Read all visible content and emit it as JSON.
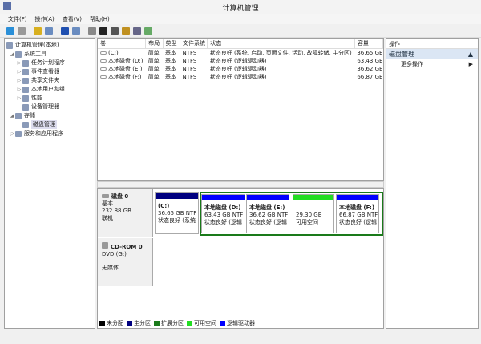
{
  "window": {
    "title": "计算机管理"
  },
  "menu": [
    "文件(F)",
    "操作(A)",
    "查看(V)",
    "帮助(H)"
  ],
  "toolbar_icons": [
    "back-icon",
    "forward-icon",
    "up-icon",
    "console-tree-icon",
    "help-icon",
    "properties-view-icon",
    "refresh-icon",
    "delete-icon",
    "properties-icon",
    "open-icon",
    "search-icon",
    "settings-icon"
  ],
  "tree": [
    {
      "label": "计算机管理(本地)",
      "level": 0,
      "icon": "computer-icon"
    },
    {
      "label": "系统工具",
      "level": 1,
      "icon": "tools-icon",
      "exp": "◢"
    },
    {
      "label": "任务计划程序",
      "level": 2,
      "icon": "clock-icon",
      "exp": "▷"
    },
    {
      "label": "事件查看器",
      "level": 2,
      "icon": "event-icon",
      "exp": "▷"
    },
    {
      "label": "共享文件夹",
      "level": 2,
      "icon": "folder-icon",
      "exp": "▷"
    },
    {
      "label": "本地用户和组",
      "level": 2,
      "icon": "users-icon",
      "exp": "▷"
    },
    {
      "label": "性能",
      "level": 2,
      "icon": "performance-icon",
      "exp": "▷"
    },
    {
      "label": "设备管理器",
      "level": 2,
      "icon": "device-icon",
      "exp": ""
    },
    {
      "label": "存储",
      "level": 1,
      "icon": "storage-icon",
      "exp": "◢"
    },
    {
      "label": "磁盘管理",
      "level": 2,
      "icon": "disk-icon",
      "exp": "",
      "selected": true
    },
    {
      "label": "服务和应用程序",
      "level": 1,
      "icon": "services-icon",
      "exp": "▷"
    }
  ],
  "volumes": {
    "headers": [
      "卷",
      "布局",
      "类型",
      "文件系统",
      "状态",
      "容量"
    ],
    "rows": [
      [
        "(C:)",
        "简单",
        "基本",
        "NTFS",
        "状态良好 (系统, 启动, 页面文件, 活动, 故障转储, 主分区)",
        "36.65 GE"
      ],
      [
        "本地磁盘 (D:)",
        "简单",
        "基本",
        "NTFS",
        "状态良好 (逻辑驱动器)",
        "63.43 GE"
      ],
      [
        "本地磁盘 (E:)",
        "简单",
        "基本",
        "NTFS",
        "状态良好 (逻辑驱动器)",
        "36.62 GE"
      ],
      [
        "本地磁盘 (F:)",
        "简单",
        "基本",
        "NTFS",
        "状态良好 (逻辑驱动器)",
        "66.87 GE"
      ]
    ]
  },
  "disks": [
    {
      "name": "磁盘 0",
      "type": "基本",
      "size": "232.88 GB",
      "state": "联机"
    },
    {
      "name": "CD-ROM 0",
      "type": "DVD (G:)",
      "state": "无媒体"
    }
  ],
  "partitions": [
    {
      "name": "(C:)",
      "size": "36.65 GB NTF",
      "status": "状态良好 (系统",
      "color": "#000080"
    },
    {
      "name": "本地磁盘 (D:)",
      "size": "63.43 GB NTF",
      "status": "状态良好 (逻辑",
      "color": "#0000ff"
    },
    {
      "name": "本地磁盘 (E:)",
      "size": "36.62 GB NTF",
      "status": "状态良好 (逻辑",
      "color": "#0000ff"
    },
    {
      "name": "",
      "size": "29.30 GB",
      "status": "可用空间",
      "color": "#22dd22"
    },
    {
      "name": "本地磁盘 (F:)",
      "size": "66.87 GB NTF",
      "status": "状态良好 (逻辑",
      "color": "#0000ff"
    }
  ],
  "legend": [
    {
      "label": "未分配",
      "color": "#000000"
    },
    {
      "label": "主分区",
      "color": "#000080"
    },
    {
      "label": "扩展分区",
      "color": "#1a7a1a"
    },
    {
      "label": "可用空间",
      "color": "#22dd22"
    },
    {
      "label": "逻辑驱动器",
      "color": "#0000ff"
    }
  ],
  "actions": {
    "header": "操作",
    "section": "磁盘管理",
    "more": "更多操作"
  }
}
